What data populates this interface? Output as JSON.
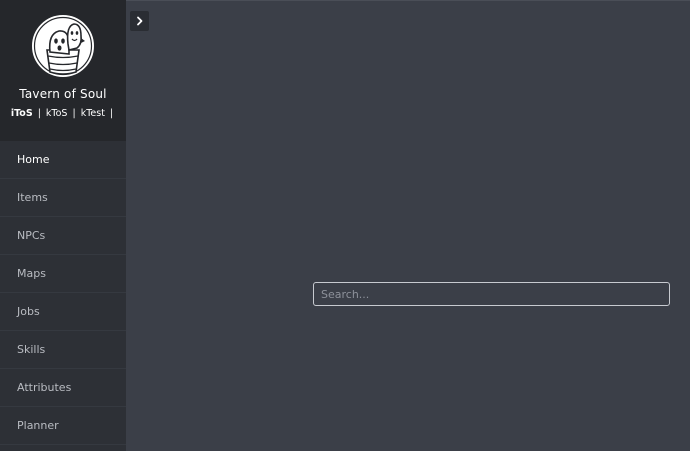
{
  "brand": {
    "logo_icon": "ghost-mascot-logo-icon",
    "title": "Tavern of Soul",
    "regions": [
      {
        "label": "iToS",
        "active": true
      },
      {
        "label": "kToS",
        "active": false
      },
      {
        "label": "kTest",
        "active": false
      }
    ],
    "separator": "|"
  },
  "nav": {
    "items": [
      {
        "label": "Home",
        "active": true
      },
      {
        "label": "Items"
      },
      {
        "label": "NPCs"
      },
      {
        "label": "Maps"
      },
      {
        "label": "Jobs"
      },
      {
        "label": "Skills"
      },
      {
        "label": "Attributes"
      },
      {
        "label": "Planner"
      }
    ]
  },
  "toggle": {
    "icon": "chevron-right-icon"
  },
  "search": {
    "placeholder": "Search...",
    "value": ""
  },
  "colors": {
    "background": "#3b3f48",
    "sidebar": "#2d3036",
    "brand_header": "#25272b",
    "active_text": "#ffffff",
    "inactive_text": "#b9bcc2"
  }
}
